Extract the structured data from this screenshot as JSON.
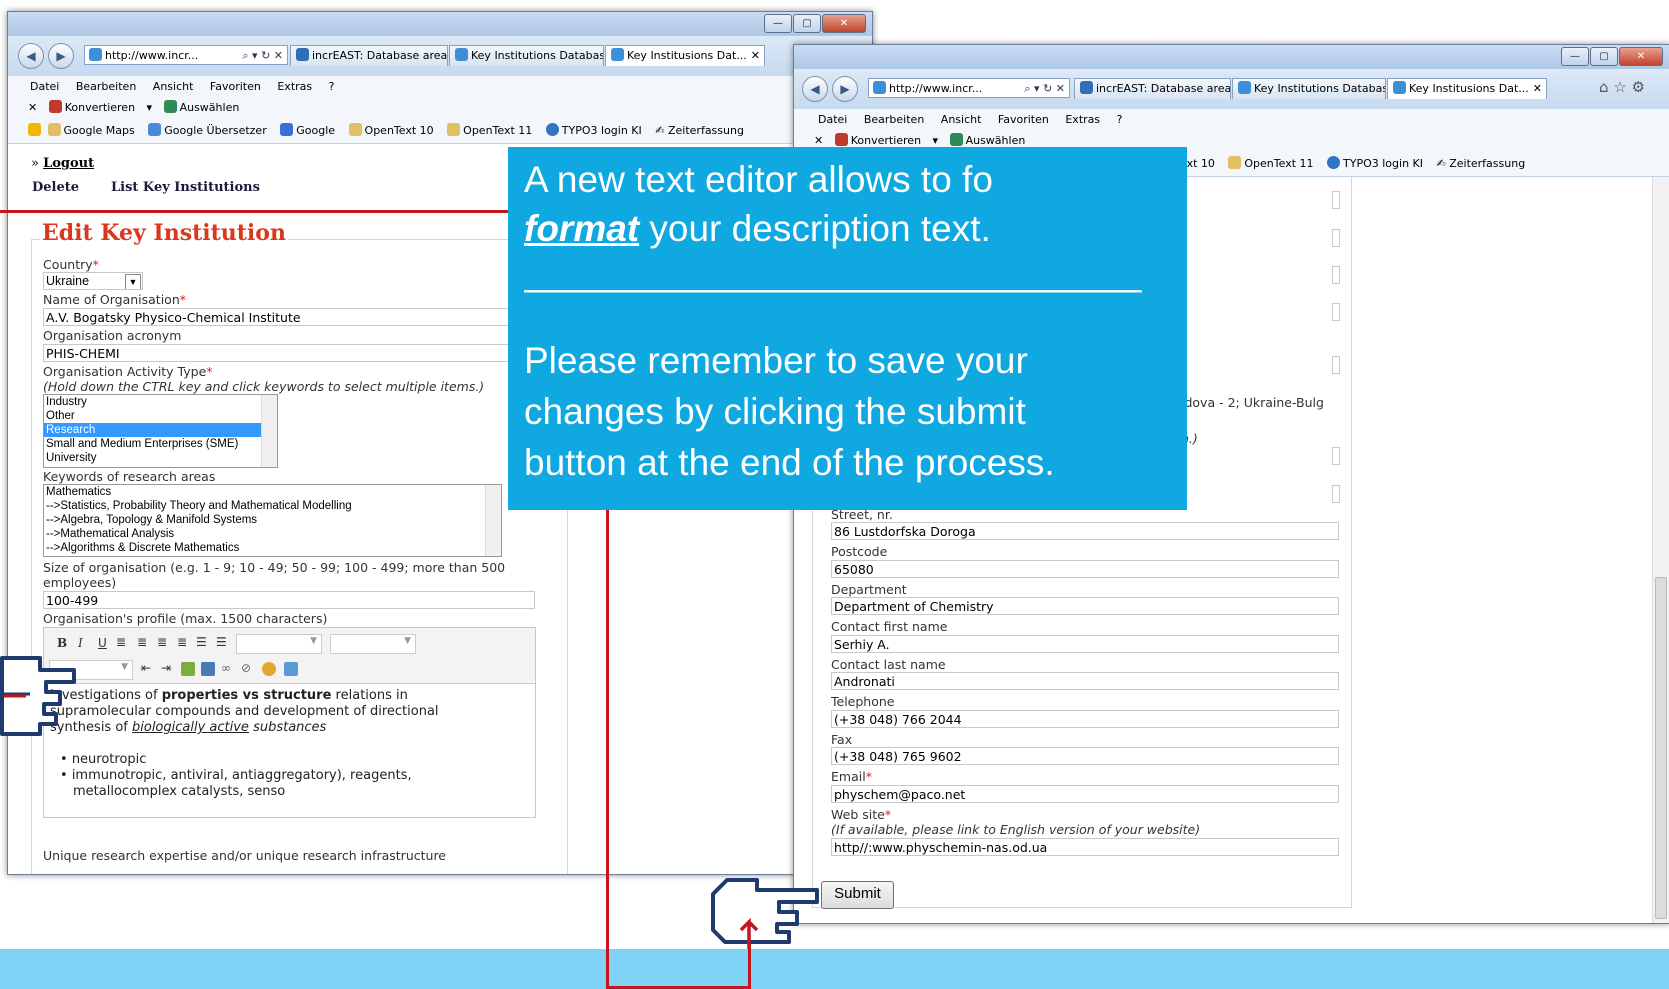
{
  "browser": {
    "url": "http://www.incr...",
    "tabs": [
      "incrEAST: Database area",
      "Key Institutions Database",
      "Key Institusions Dat..."
    ],
    "menu": [
      "Datei",
      "Bearbeiten",
      "Ansicht",
      "Favoriten",
      "Extras",
      "?"
    ],
    "cmd": {
      "convert": "Konvertieren",
      "select": "Auswählen"
    },
    "favorites": [
      "Google Maps",
      "Google Übersetzer",
      "Google",
      "OpenText 10",
      "OpenText 11",
      "TYPO3 login KI",
      "Zeiterfassung"
    ],
    "favorites_partial": [
      "ext 10",
      "OpenText 11",
      "TYPO3 login KI",
      "Zeiterfassung"
    ]
  },
  "left": {
    "logout": "Logout",
    "delete": "Delete",
    "list_institutions": "List Key Institutions",
    "heading": "Edit Key Institution",
    "country_label": "Country",
    "country_value": "Ukraine",
    "org_name_label": "Name of Organisation",
    "org_name_value": "A.V. Bogatsky Physico-Chemical Institute",
    "acronym_label": "Organisation acronym",
    "acronym_value": "PHIS-CHEMI",
    "activity_label": "Organisation Activity Type",
    "activity_hint": "(Hold down the CTRL key and click keywords to select multiple items.)",
    "activity_items": [
      "Industry",
      "Other",
      "Research",
      "Small and Medium Enterprises (SME)",
      "University"
    ],
    "keywords_label": "Keywords of research areas",
    "keywords_items": [
      "Mathematics",
      "-->Statistics, Probability Theory and Mathematical Modelling",
      "-->Algebra, Topology & Manifold Systems",
      "-->Mathematical Analysis",
      "-->Algorithms & Discrete Mathematics"
    ],
    "size_label": "Size of organisation (e.g. 1 - 9; 10 - 49; 50 - 99; 100 - 499; more than 500",
    "size_label2": "employees)",
    "size_value": "100-499",
    "profile_label": "Organisation's profile (max. 1500 characters)",
    "profile": {
      "p1a": "investigations of ",
      "p1b": "properties vs structure",
      "p1c": " relations in",
      "p2": "supramolecular compounds and development of directional",
      "p3a": "synthesis of ",
      "p3b": "biologically active",
      "p3c": " substances",
      "bullet1": "neurotropic",
      "bullet2a": "immunotropic, antiviral, antiaggregatory), reagents,",
      "bullet2b": "metallocomplex catalysts, senso"
    },
    "expertise_label": "Unique research expertise and/or unique research infrastructure"
  },
  "right": {
    "partial_country_text": "ldova - 2; Ukraine-Bulg",
    "partial_hint": "n.)",
    "street_label": "Street, nr.",
    "street_value": "86 Lustdorfska Doroga",
    "postcode_label": "Postcode",
    "postcode_value": "65080",
    "department_label": "Department",
    "department_value": "Department of Chemistry",
    "first_name_label": "Contact first name",
    "first_name_value": "Serhiy A.",
    "last_name_label": "Contact last name",
    "last_name_value": "Andronati",
    "telephone_label": "Telephone",
    "telephone_value": "(+38 048) 766 2044",
    "fax_label": "Fax",
    "fax_value": "(+38 048) 765 9602",
    "email_label": "Email",
    "email_value": "physchem@paco.net",
    "website_label": "Web site",
    "website_hint": "(If available, please link to English version of your website)",
    "website_value": "http//:www.physchemin-nas.od.ua",
    "submit": "Submit"
  },
  "callout": {
    "line1": "A new text editor allows to fo",
    "line2_em": "format",
    "line2_rest": " your description text.",
    "separator": "______________________________",
    "line3": "Please remember to save your",
    "line4": "changes by clicking the submit",
    "line5": "button at the end of the process."
  },
  "colors": {
    "callout_bg": "#0fa8e0",
    "bottom_band": "#7fd3f7",
    "accent_red": "#c4161c",
    "heading_red": "#d9381e"
  }
}
